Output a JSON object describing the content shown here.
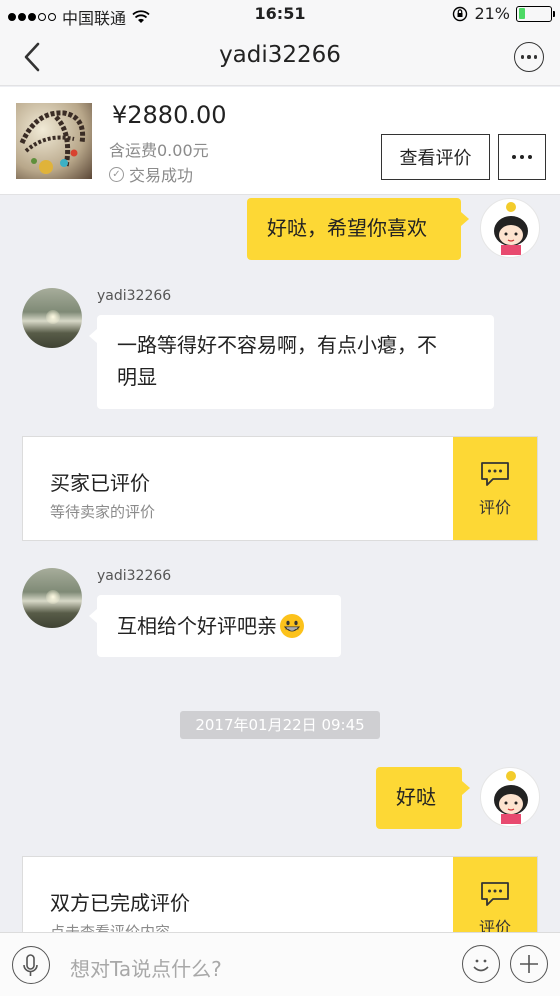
{
  "status_bar": {
    "carrier": "中国联通",
    "time": "16:51",
    "battery": "21%",
    "battery_level": 0.21
  },
  "nav": {
    "title": "yadi32266"
  },
  "order": {
    "price": "¥2880.00",
    "shipping": "含运费0.00元",
    "status": "交易成功",
    "view_button": "查看评价"
  },
  "messages": [
    {
      "text": "好哒，希望你喜欢"
    },
    {
      "sender": "yadi32266",
      "text_line1": "一路等得好不容易啊，有点小瘪，不",
      "text_line2": "明显"
    },
    {
      "sender": "yadi32266",
      "text": "互相给个好评吧亲"
    },
    {
      "text": "好哒"
    }
  ],
  "cards": [
    {
      "title": "买家已评价",
      "subtitle": "等待卖家的评价",
      "button": "评价"
    },
    {
      "title": "双方已完成评价",
      "subtitle": "点击查看评价内容",
      "button": "评价"
    }
  ],
  "timestamp": "2017年01月22日 09:45",
  "input": {
    "placeholder": "想对Ta说点什么?"
  }
}
